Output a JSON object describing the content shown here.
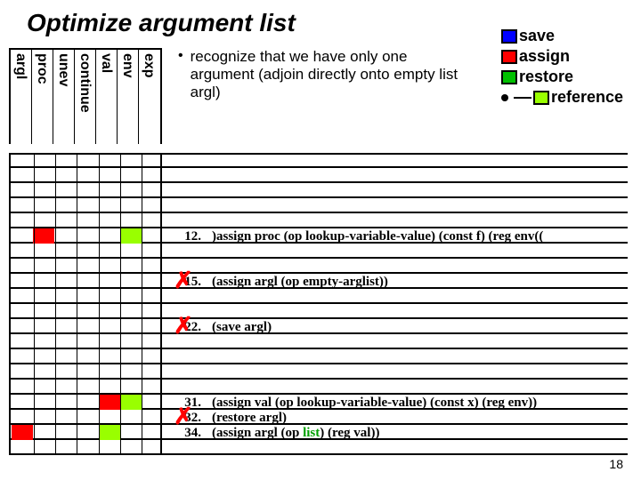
{
  "title": "Optimize argument list",
  "legend": {
    "save": "save",
    "assign": "assign",
    "restore": "restore",
    "reference": "reference"
  },
  "bullet": "recognize that we have only one argument (adjoin directly onto empty list argl)",
  "columns": [
    "exp",
    "env",
    "val",
    "continue",
    "unev",
    "proc",
    "argl"
  ],
  "instructions": [
    {
      "num": "12.",
      "text": ")assign proc (op lookup-variable-value) (const f) (reg env((",
      "crossed": false
    },
    {
      "num": "15.",
      "text": "(assign argl (op empty-arglist))",
      "crossed": true
    },
    {
      "num": "22.",
      "text": "(save argl)",
      "crossed": true
    },
    {
      "num": "31.",
      "text": "(assign val (op lookup-variable-value) (const x) (reg env))",
      "crossed": false
    },
    {
      "num": "32.",
      "text": "(restore argl)",
      "crossed": true
    },
    {
      "num": "34.",
      "text_pre": "(assign argl (op ",
      "text_green": "list",
      "text_post": ") (reg val))",
      "special": true
    }
  ],
  "slide_number": "18"
}
